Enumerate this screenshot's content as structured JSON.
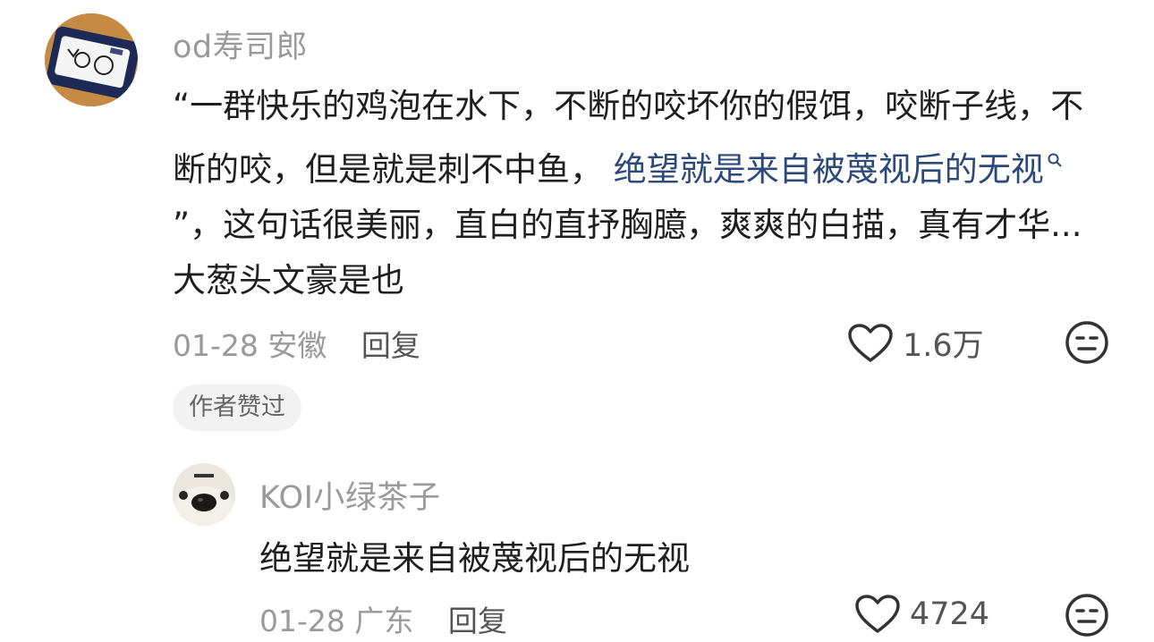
{
  "comment": {
    "username": "od寿司郎",
    "text_before_link": "“一群快乐的鸡泡在水下，不断的咬坏你的假饵，咬断子线，不断的咬，但是就是刺不中鱼， ",
    "link_text": "绝望就是来自被蔑视后的无视",
    "link_icon": "search-icon",
    "text_after_link": "”，这句话很美丽，直白的直抒胸臆，爽爽的白描，真有才华...大葱头文豪是也",
    "date": "01-28",
    "location": "安徽",
    "reply_label": "回复",
    "likes": "1.6万",
    "author_badge": "作者赞过"
  },
  "reply": {
    "username": "KOI小绿茶子",
    "text": "绝望就是来自被蔑视后的无视",
    "date": "01-28",
    "location": "广东",
    "reply_label": "回复",
    "likes": "4724"
  },
  "colors": {
    "link": "#2b4a7a",
    "meta": "#9a9a9a",
    "badge_bg": "#f2f2f2"
  }
}
